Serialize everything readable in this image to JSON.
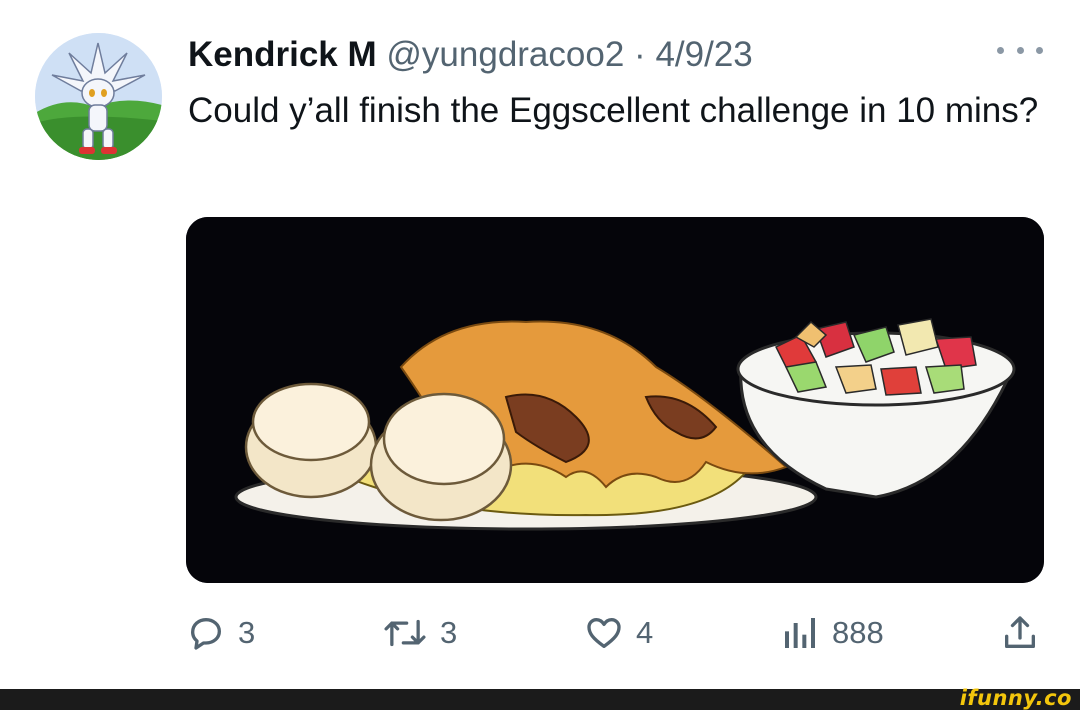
{
  "tweet": {
    "display_name": "Kendrick M",
    "handle": "@yungdracoo2",
    "separator": "·",
    "date": "4/9/23",
    "text": "Could y’all finish the Eggscellent challenge in 10 mins?",
    "more_icon": "more-horizontal-icon"
  },
  "actions": {
    "replies": "3",
    "retweets": "3",
    "likes": "4",
    "views": "888",
    "icons": [
      "reply-icon",
      "retweet-icon",
      "like-icon",
      "views-icon",
      "share-icon"
    ]
  },
  "footer": {
    "brand": "ifunny.co"
  },
  "colors": {
    "text": "#0f1419",
    "secondary": "#536471",
    "media_background": "#05050a",
    "footer": "#1b1b1b",
    "brand": "#f3c60c"
  }
}
